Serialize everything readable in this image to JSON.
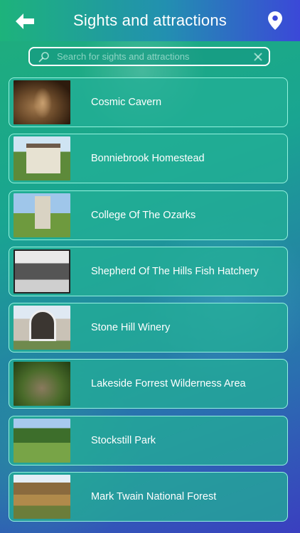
{
  "header": {
    "title": "Sights and attractions",
    "back_icon": "back-arrow-icon",
    "map_icon": "map-pin-icon"
  },
  "search": {
    "placeholder": "Search for sights and attractions",
    "value": ""
  },
  "colors": {
    "header_start": "#1db37b",
    "header_end": "#3b48d8",
    "card_bg": "#23af96",
    "text": "#ffffff"
  },
  "items": [
    {
      "label": "Cosmic Cavern",
      "thumb": "cavern"
    },
    {
      "label": "Bonniebrook Homestead",
      "thumb": "house"
    },
    {
      "label": "College Of The Ozarks",
      "thumb": "college"
    },
    {
      "label": "Shepherd Of The Hills Fish Hatchery",
      "thumb": "hatchery"
    },
    {
      "label": "Stone Hill Winery",
      "thumb": "winery"
    },
    {
      "label": "Lakeside Forrest Wilderness Area",
      "thumb": "lakeside"
    },
    {
      "label": "Stockstill Park",
      "thumb": "park"
    },
    {
      "label": "Mark Twain National Forest",
      "thumb": "forest"
    }
  ]
}
